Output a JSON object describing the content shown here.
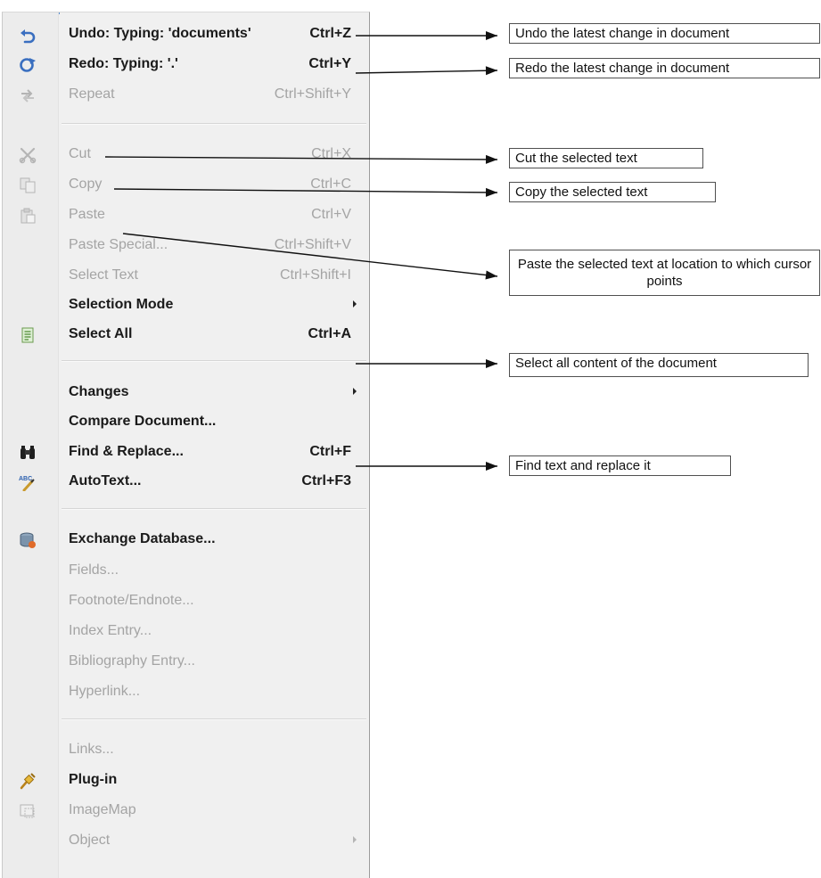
{
  "menu": {
    "items": [
      {
        "label": "Undo: Typing: 'documents'",
        "shortcut": "Ctrl+Z",
        "icon": "undo-icon",
        "enabled": true,
        "submenu": false
      },
      {
        "label": "Redo: Typing: '.'",
        "shortcut": "Ctrl+Y",
        "icon": "redo-icon",
        "enabled": true,
        "submenu": false
      },
      {
        "label": "Repeat",
        "shortcut": "Ctrl+Shift+Y",
        "icon": "repeat-icon",
        "enabled": false,
        "submenu": false
      },
      {
        "label": "Cut",
        "shortcut": "Ctrl+X",
        "icon": "scissors-icon",
        "enabled": false,
        "submenu": false
      },
      {
        "label": "Copy",
        "shortcut": "Ctrl+C",
        "icon": "copy-icon",
        "enabled": false,
        "submenu": false
      },
      {
        "label": "Paste",
        "shortcut": "Ctrl+V",
        "icon": "paste-icon",
        "enabled": false,
        "submenu": false
      },
      {
        "label": "Paste Special...",
        "shortcut": "Ctrl+Shift+V",
        "icon": "",
        "enabled": false,
        "submenu": false
      },
      {
        "label": "Select Text",
        "shortcut": "Ctrl+Shift+I",
        "icon": "",
        "enabled": false,
        "submenu": false
      },
      {
        "label": "Selection Mode",
        "shortcut": "",
        "icon": "",
        "enabled": true,
        "submenu": true
      },
      {
        "label": "Select All",
        "shortcut": "Ctrl+A",
        "icon": "select-all-icon",
        "enabled": true,
        "submenu": false
      },
      {
        "label": "Changes",
        "shortcut": "",
        "icon": "",
        "enabled": true,
        "submenu": true
      },
      {
        "label": "Compare Document...",
        "shortcut": "",
        "icon": "",
        "enabled": true,
        "submenu": false
      },
      {
        "label": "Find & Replace...",
        "shortcut": "Ctrl+F",
        "icon": "binoculars-icon",
        "enabled": true,
        "submenu": false
      },
      {
        "label": "AutoText...",
        "shortcut": "Ctrl+F3",
        "icon": "autotext-icon",
        "enabled": true,
        "submenu": false
      },
      {
        "label": "Exchange Database...",
        "shortcut": "",
        "icon": "database-icon",
        "enabled": true,
        "submenu": false
      },
      {
        "label": "Fields...",
        "shortcut": "",
        "icon": "",
        "enabled": false,
        "submenu": false
      },
      {
        "label": "Footnote/Endnote...",
        "shortcut": "",
        "icon": "",
        "enabled": false,
        "submenu": false
      },
      {
        "label": "Index Entry...",
        "shortcut": "",
        "icon": "",
        "enabled": false,
        "submenu": false
      },
      {
        "label": "Bibliography Entry...",
        "shortcut": "",
        "icon": "",
        "enabled": false,
        "submenu": false
      },
      {
        "label": "Hyperlink...",
        "shortcut": "",
        "icon": "",
        "enabled": false,
        "submenu": false
      },
      {
        "label": "Links...",
        "shortcut": "",
        "icon": "",
        "enabled": false,
        "submenu": false
      },
      {
        "label": "Plug-in",
        "shortcut": "",
        "icon": "plugin-icon",
        "enabled": true,
        "submenu": false
      },
      {
        "label": "ImageMap",
        "shortcut": "",
        "icon": "imagemap-icon",
        "enabled": false,
        "submenu": false
      },
      {
        "label": "Object",
        "shortcut": "",
        "icon": "",
        "enabled": false,
        "submenu": true
      }
    ]
  },
  "annotations": [
    {
      "text": "Undo the latest change in document"
    },
    {
      "text": "Redo the latest change in document"
    },
    {
      "text": "Cut the selected text"
    },
    {
      "text": "Copy the selected text"
    },
    {
      "text": "Paste the selected text at location to which cursor points"
    },
    {
      "text": "Select all content of the document"
    },
    {
      "text": "Find text and replace it"
    }
  ]
}
